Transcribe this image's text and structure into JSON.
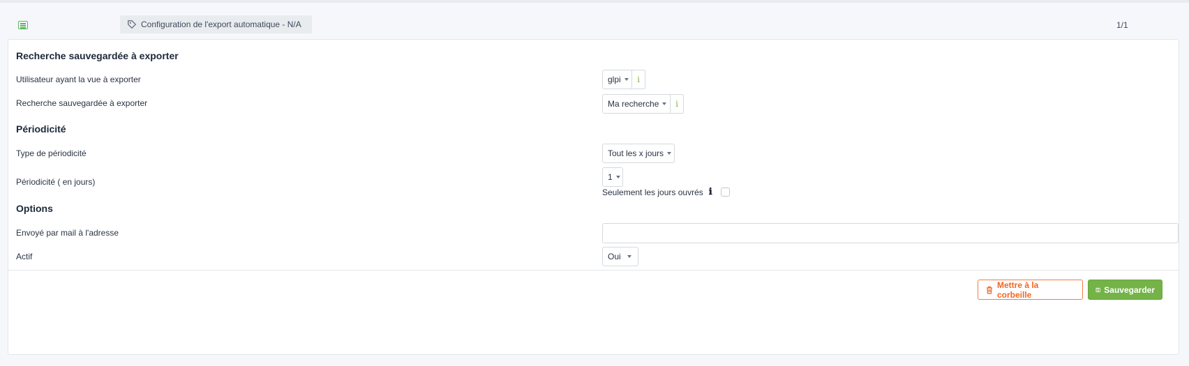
{
  "header": {
    "tab_title": "Configuration de l'export automatique - N/A",
    "pager": "1/1"
  },
  "sections": {
    "saved_search": "Recherche sauvegardée à exporter",
    "periodicity": "Périodicité",
    "options": "Options"
  },
  "fields": {
    "user_label": "Utilisateur ayant la vue à exporter",
    "user_value": "glpi",
    "search_label": "Recherche sauvegardée à exporter",
    "search_value": "Ma recherche",
    "period_type_label": "Type de périodicité",
    "period_type_value": "Tout les x jours",
    "period_days_label": "Périodicité ( en jours)",
    "period_days_value": "1",
    "workdays_label": "Seulement les jours ouvrés",
    "workdays_checked": false,
    "email_label": "Envoyé par mail à l'adresse",
    "email_value": "",
    "active_label": "Actif",
    "active_value": "Oui"
  },
  "info_glyph": "i",
  "info_glyph_bold": "ℹ",
  "actions": {
    "trash_label": "Mettre à la corbeille",
    "save_label": "Sauvegarder"
  },
  "icons": {
    "list": "list-icon",
    "tag": "tag-icon",
    "info": "info-icon",
    "trash": "trash-icon",
    "save": "floppy-disk-icon"
  },
  "colors": {
    "accent_green": "#74b347",
    "danger_orange": "#f26522",
    "background": "#f5f7fb"
  }
}
